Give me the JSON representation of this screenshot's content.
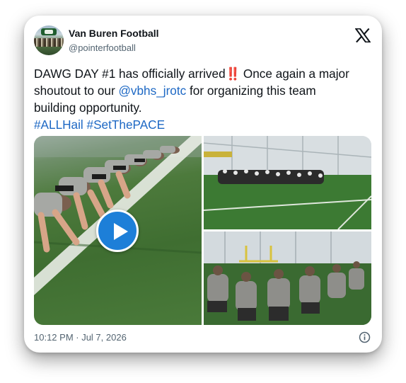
{
  "account": {
    "name": "Van Buren Football",
    "handle": "@pointerfootball",
    "avatar_icon": "team-photo-avatar"
  },
  "platform_icon": "x-logo-icon",
  "tweet": {
    "line1_prefix": "DAWG DAY #1 has officially arrived",
    "emoji": "‼️",
    "line1_suffix": " Once again a major",
    "line2_prefix": "shoutout to our ",
    "mention": "@vbhs_jrotc",
    "line2_suffix": " for organizing this team",
    "line3": "building opportunity.",
    "hashtag1": "#ALLHail",
    "hashtag2": "#SetThePACE"
  },
  "media": {
    "items": [
      {
        "kind": "video",
        "icon": "play-icon"
      },
      {
        "kind": "photo"
      },
      {
        "kind": "photo"
      }
    ]
  },
  "footer": {
    "timestamp": "10:12 PM · Jul 7, 2026",
    "info_icon": "info-icon"
  },
  "colors": {
    "link": "#1d68c4",
    "play_button": "#1d7fd8",
    "emoji": "#e0202e"
  }
}
